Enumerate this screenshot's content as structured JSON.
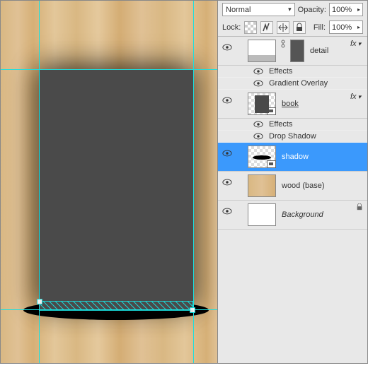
{
  "toolbar": {
    "blend_mode": "Normal",
    "opacity_label": "Opacity:",
    "opacity_value": "100%",
    "lock_label": "Lock:",
    "fill_label": "Fill:",
    "fill_value": "100%"
  },
  "layers": [
    {
      "name": "detail",
      "fx": true,
      "effects": [
        "Gradient Overlay"
      ],
      "underline": false,
      "has_mask": true,
      "thumb": "detail"
    },
    {
      "name": "book",
      "fx": true,
      "effects": [
        "Drop Shadow"
      ],
      "underline": true,
      "has_mask": false,
      "thumb": "book",
      "smart": true
    },
    {
      "name": "shadow",
      "selected": true,
      "thumb": "shadow",
      "smart": true
    },
    {
      "name": "wood (base)",
      "thumb": "wood"
    },
    {
      "name": "Background",
      "thumb": "bg",
      "locked": true,
      "italic": true
    }
  ],
  "effects_label": "Effects",
  "fx_glyph": "fx"
}
